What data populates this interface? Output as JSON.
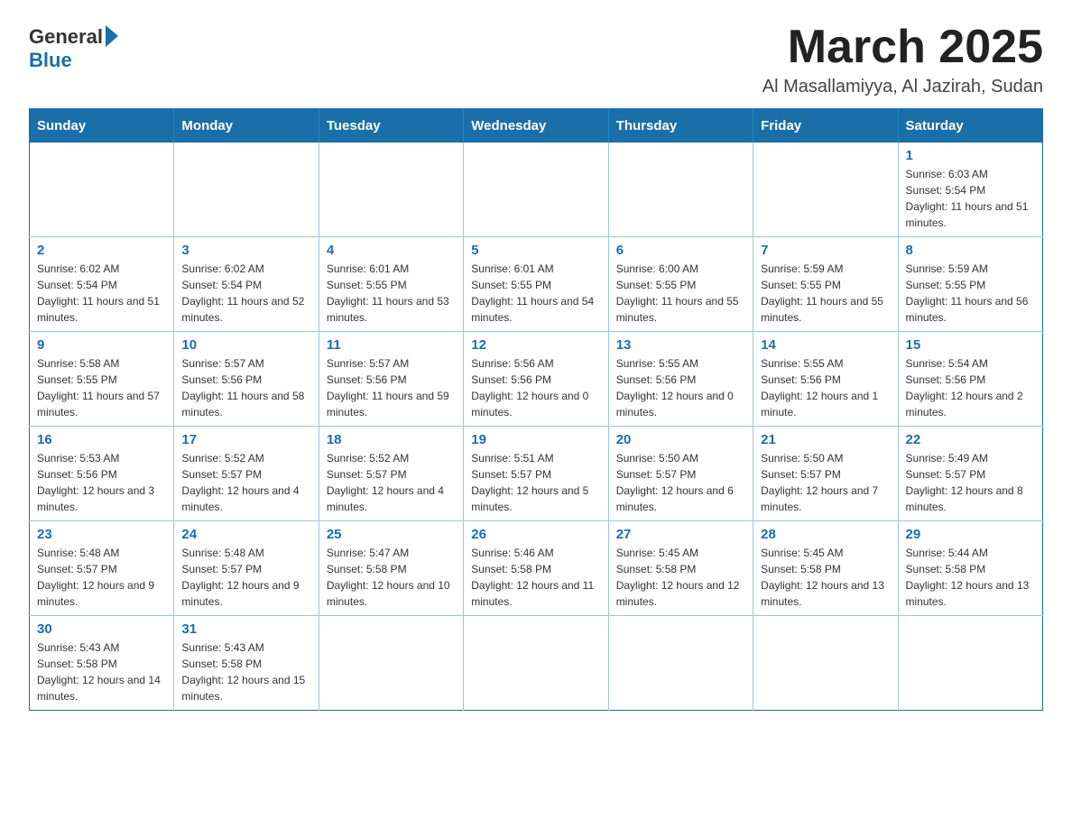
{
  "logo": {
    "general": "General",
    "blue": "Blue"
  },
  "title": "March 2025",
  "subtitle": "Al Masallamiyya, Al Jazirah, Sudan",
  "days_of_week": [
    "Sunday",
    "Monday",
    "Tuesday",
    "Wednesday",
    "Thursday",
    "Friday",
    "Saturday"
  ],
  "weeks": [
    [
      {
        "day": "",
        "sunrise": "",
        "sunset": "",
        "daylight": ""
      },
      {
        "day": "",
        "sunrise": "",
        "sunset": "",
        "daylight": ""
      },
      {
        "day": "",
        "sunrise": "",
        "sunset": "",
        "daylight": ""
      },
      {
        "day": "",
        "sunrise": "",
        "sunset": "",
        "daylight": ""
      },
      {
        "day": "",
        "sunrise": "",
        "sunset": "",
        "daylight": ""
      },
      {
        "day": "",
        "sunrise": "",
        "sunset": "",
        "daylight": ""
      },
      {
        "day": "1",
        "sunrise": "Sunrise: 6:03 AM",
        "sunset": "Sunset: 5:54 PM",
        "daylight": "Daylight: 11 hours and 51 minutes."
      }
    ],
    [
      {
        "day": "2",
        "sunrise": "Sunrise: 6:02 AM",
        "sunset": "Sunset: 5:54 PM",
        "daylight": "Daylight: 11 hours and 51 minutes."
      },
      {
        "day": "3",
        "sunrise": "Sunrise: 6:02 AM",
        "sunset": "Sunset: 5:54 PM",
        "daylight": "Daylight: 11 hours and 52 minutes."
      },
      {
        "day": "4",
        "sunrise": "Sunrise: 6:01 AM",
        "sunset": "Sunset: 5:55 PM",
        "daylight": "Daylight: 11 hours and 53 minutes."
      },
      {
        "day": "5",
        "sunrise": "Sunrise: 6:01 AM",
        "sunset": "Sunset: 5:55 PM",
        "daylight": "Daylight: 11 hours and 54 minutes."
      },
      {
        "day": "6",
        "sunrise": "Sunrise: 6:00 AM",
        "sunset": "Sunset: 5:55 PM",
        "daylight": "Daylight: 11 hours and 55 minutes."
      },
      {
        "day": "7",
        "sunrise": "Sunrise: 5:59 AM",
        "sunset": "Sunset: 5:55 PM",
        "daylight": "Daylight: 11 hours and 55 minutes."
      },
      {
        "day": "8",
        "sunrise": "Sunrise: 5:59 AM",
        "sunset": "Sunset: 5:55 PM",
        "daylight": "Daylight: 11 hours and 56 minutes."
      }
    ],
    [
      {
        "day": "9",
        "sunrise": "Sunrise: 5:58 AM",
        "sunset": "Sunset: 5:55 PM",
        "daylight": "Daylight: 11 hours and 57 minutes."
      },
      {
        "day": "10",
        "sunrise": "Sunrise: 5:57 AM",
        "sunset": "Sunset: 5:56 PM",
        "daylight": "Daylight: 11 hours and 58 minutes."
      },
      {
        "day": "11",
        "sunrise": "Sunrise: 5:57 AM",
        "sunset": "Sunset: 5:56 PM",
        "daylight": "Daylight: 11 hours and 59 minutes."
      },
      {
        "day": "12",
        "sunrise": "Sunrise: 5:56 AM",
        "sunset": "Sunset: 5:56 PM",
        "daylight": "Daylight: 12 hours and 0 minutes."
      },
      {
        "day": "13",
        "sunrise": "Sunrise: 5:55 AM",
        "sunset": "Sunset: 5:56 PM",
        "daylight": "Daylight: 12 hours and 0 minutes."
      },
      {
        "day": "14",
        "sunrise": "Sunrise: 5:55 AM",
        "sunset": "Sunset: 5:56 PM",
        "daylight": "Daylight: 12 hours and 1 minute."
      },
      {
        "day": "15",
        "sunrise": "Sunrise: 5:54 AM",
        "sunset": "Sunset: 5:56 PM",
        "daylight": "Daylight: 12 hours and 2 minutes."
      }
    ],
    [
      {
        "day": "16",
        "sunrise": "Sunrise: 5:53 AM",
        "sunset": "Sunset: 5:56 PM",
        "daylight": "Daylight: 12 hours and 3 minutes."
      },
      {
        "day": "17",
        "sunrise": "Sunrise: 5:52 AM",
        "sunset": "Sunset: 5:57 PM",
        "daylight": "Daylight: 12 hours and 4 minutes."
      },
      {
        "day": "18",
        "sunrise": "Sunrise: 5:52 AM",
        "sunset": "Sunset: 5:57 PM",
        "daylight": "Daylight: 12 hours and 4 minutes."
      },
      {
        "day": "19",
        "sunrise": "Sunrise: 5:51 AM",
        "sunset": "Sunset: 5:57 PM",
        "daylight": "Daylight: 12 hours and 5 minutes."
      },
      {
        "day": "20",
        "sunrise": "Sunrise: 5:50 AM",
        "sunset": "Sunset: 5:57 PM",
        "daylight": "Daylight: 12 hours and 6 minutes."
      },
      {
        "day": "21",
        "sunrise": "Sunrise: 5:50 AM",
        "sunset": "Sunset: 5:57 PM",
        "daylight": "Daylight: 12 hours and 7 minutes."
      },
      {
        "day": "22",
        "sunrise": "Sunrise: 5:49 AM",
        "sunset": "Sunset: 5:57 PM",
        "daylight": "Daylight: 12 hours and 8 minutes."
      }
    ],
    [
      {
        "day": "23",
        "sunrise": "Sunrise: 5:48 AM",
        "sunset": "Sunset: 5:57 PM",
        "daylight": "Daylight: 12 hours and 9 minutes."
      },
      {
        "day": "24",
        "sunrise": "Sunrise: 5:48 AM",
        "sunset": "Sunset: 5:57 PM",
        "daylight": "Daylight: 12 hours and 9 minutes."
      },
      {
        "day": "25",
        "sunrise": "Sunrise: 5:47 AM",
        "sunset": "Sunset: 5:58 PM",
        "daylight": "Daylight: 12 hours and 10 minutes."
      },
      {
        "day": "26",
        "sunrise": "Sunrise: 5:46 AM",
        "sunset": "Sunset: 5:58 PM",
        "daylight": "Daylight: 12 hours and 11 minutes."
      },
      {
        "day": "27",
        "sunrise": "Sunrise: 5:45 AM",
        "sunset": "Sunset: 5:58 PM",
        "daylight": "Daylight: 12 hours and 12 minutes."
      },
      {
        "day": "28",
        "sunrise": "Sunrise: 5:45 AM",
        "sunset": "Sunset: 5:58 PM",
        "daylight": "Daylight: 12 hours and 13 minutes."
      },
      {
        "day": "29",
        "sunrise": "Sunrise: 5:44 AM",
        "sunset": "Sunset: 5:58 PM",
        "daylight": "Daylight: 12 hours and 13 minutes."
      }
    ],
    [
      {
        "day": "30",
        "sunrise": "Sunrise: 5:43 AM",
        "sunset": "Sunset: 5:58 PM",
        "daylight": "Daylight: 12 hours and 14 minutes."
      },
      {
        "day": "31",
        "sunrise": "Sunrise: 5:43 AM",
        "sunset": "Sunset: 5:58 PM",
        "daylight": "Daylight: 12 hours and 15 minutes."
      },
      {
        "day": "",
        "sunrise": "",
        "sunset": "",
        "daylight": ""
      },
      {
        "day": "",
        "sunrise": "",
        "sunset": "",
        "daylight": ""
      },
      {
        "day": "",
        "sunrise": "",
        "sunset": "",
        "daylight": ""
      },
      {
        "day": "",
        "sunrise": "",
        "sunset": "",
        "daylight": ""
      },
      {
        "day": "",
        "sunrise": "",
        "sunset": "",
        "daylight": ""
      }
    ]
  ]
}
